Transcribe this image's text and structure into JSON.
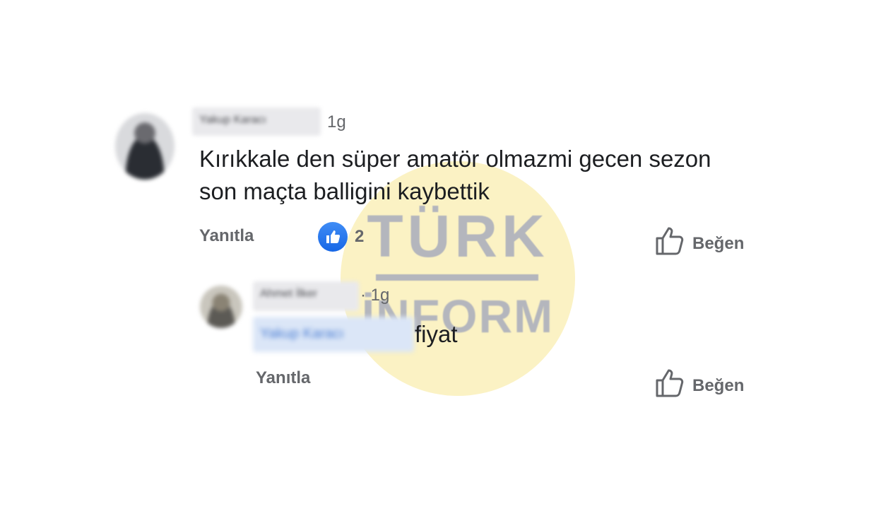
{
  "watermark": {
    "line1": "TÜRK",
    "line2": "İNFORM"
  },
  "comment": {
    "author": "Yakup Karacı",
    "time": "1g",
    "text": "Kırıkkale den süper amatör olmazmi gecen sezon son maçta balligini kaybettik",
    "reply_label": "Yanıtla",
    "reaction_count": "2",
    "like_label": "Beğen"
  },
  "reply": {
    "author": "Ahmet İlker",
    "time": "· 1g",
    "mention": "Yakup Karacı",
    "text": "fiyat",
    "reply_label": "Yanıtla",
    "like_label": "Beğen"
  },
  "colors": {
    "text": "#1c1e21",
    "secondary": "#65676b",
    "like_blue": "#1877f2",
    "watermark_circle": "#fbf2c4",
    "watermark_text": "#b4b6bd"
  }
}
